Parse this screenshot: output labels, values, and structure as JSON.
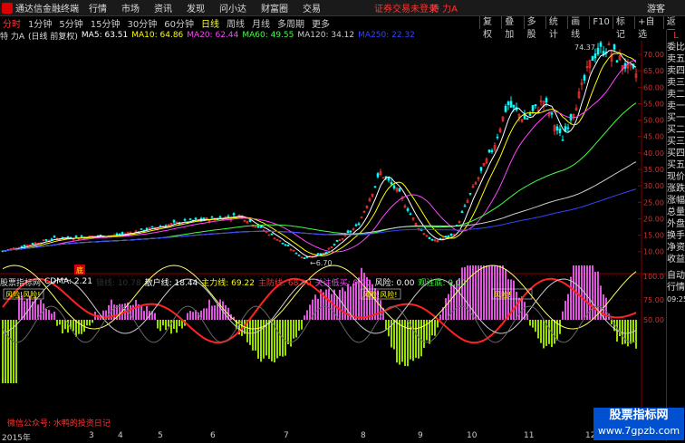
{
  "topbar": {
    "app_name": "通达信金融终端",
    "menu": [
      "行情",
      "市场",
      "资讯",
      "发现",
      "问小达",
      "财富圈",
      "交易"
    ],
    "trade_warning": "证券交易未登录",
    "stock_title": "特 力A",
    "guest": "游客"
  },
  "periods": [
    "分时",
    "1分钟",
    "5分钟",
    "15分钟",
    "30分钟",
    "60分钟",
    "日线",
    "周线",
    "月线",
    "多周期",
    "更多"
  ],
  "active_period": "日线",
  "toolbar_right": [
    "复权",
    "叠加",
    "多股",
    "统计",
    "画线",
    "F10",
    "标记",
    "+自选",
    "返回"
  ],
  "main_header": {
    "stock": "特 力A",
    "mode": "(日线 前复权)",
    "ma": [
      {
        "label": "MA5: 63.51",
        "color": "#ffffff"
      },
      {
        "label": "MA10: 64.86",
        "color": "#ffff00"
      },
      {
        "label": "MA20: 62.44",
        "color": "#ff44ff"
      },
      {
        "label": "MA60: 49.55",
        "color": "#44ff44"
      },
      {
        "label": "MA120: 34.12",
        "color": "#cccccc"
      },
      {
        "label": "MA250: 22.32",
        "color": "#3344ff"
      }
    ]
  },
  "price_axis": [
    "70.00",
    "65.00",
    "60.00",
    "55.00",
    "50.00",
    "45.00",
    "40.00",
    "35.00",
    "30.00",
    "25.00",
    "20.00",
    "15.00",
    "10.00"
  ],
  "annotations": {
    "high": "74.37",
    "low": "6.70",
    "marker": "底"
  },
  "indicator_header": {
    "name": "股票指标网",
    "items": [
      {
        "label": "CDMA: 2.21",
        "color": "#ffffff"
      },
      {
        "label": "锁线: 10.78",
        "color": "#333333"
      },
      {
        "label": "散户线: 18.44",
        "color": "#ffffff"
      },
      {
        "label": "主力线: 69.22",
        "color": "#ffff00"
      },
      {
        "label": "主防线: 68.00",
        "color": "#ff3333"
      },
      {
        "label": "关注低买: 0.00",
        "color": "#ff44ff"
      },
      {
        "label": "风险: 0.00",
        "color": "#ffffff"
      },
      {
        "label": "观注底: 0.00",
        "color": "#44ff44"
      }
    ]
  },
  "indicator_axis": [
    "100.0",
    "75.00",
    "50.00"
  ],
  "indicator_labels": [
    "风险!风险!",
    "风险!风险!",
    "风险!"
  ],
  "wechat": "微信公众号: 水鸭的投资日记",
  "bottom_axis": [
    "2015年",
    "3",
    "4",
    "5",
    "6",
    "7",
    "8",
    "9",
    "10",
    "11",
    "12"
  ],
  "right_panel": {
    "top": [
      "L",
      "委比",
      "卖五",
      "卖四",
      "卖三",
      "卖二",
      "卖一",
      "买一",
      "买二",
      "买三",
      "买四",
      "买五",
      "现价",
      "涨跌",
      "涨幅",
      "总量",
      "外盘",
      "换手",
      "净资",
      "收益"
    ],
    "bottom": [
      "自动",
      "行情",
      "09:25"
    ]
  },
  "watermark": {
    "line1": "股票指标网",
    "line2": "www.7gpzb.com"
  }
}
